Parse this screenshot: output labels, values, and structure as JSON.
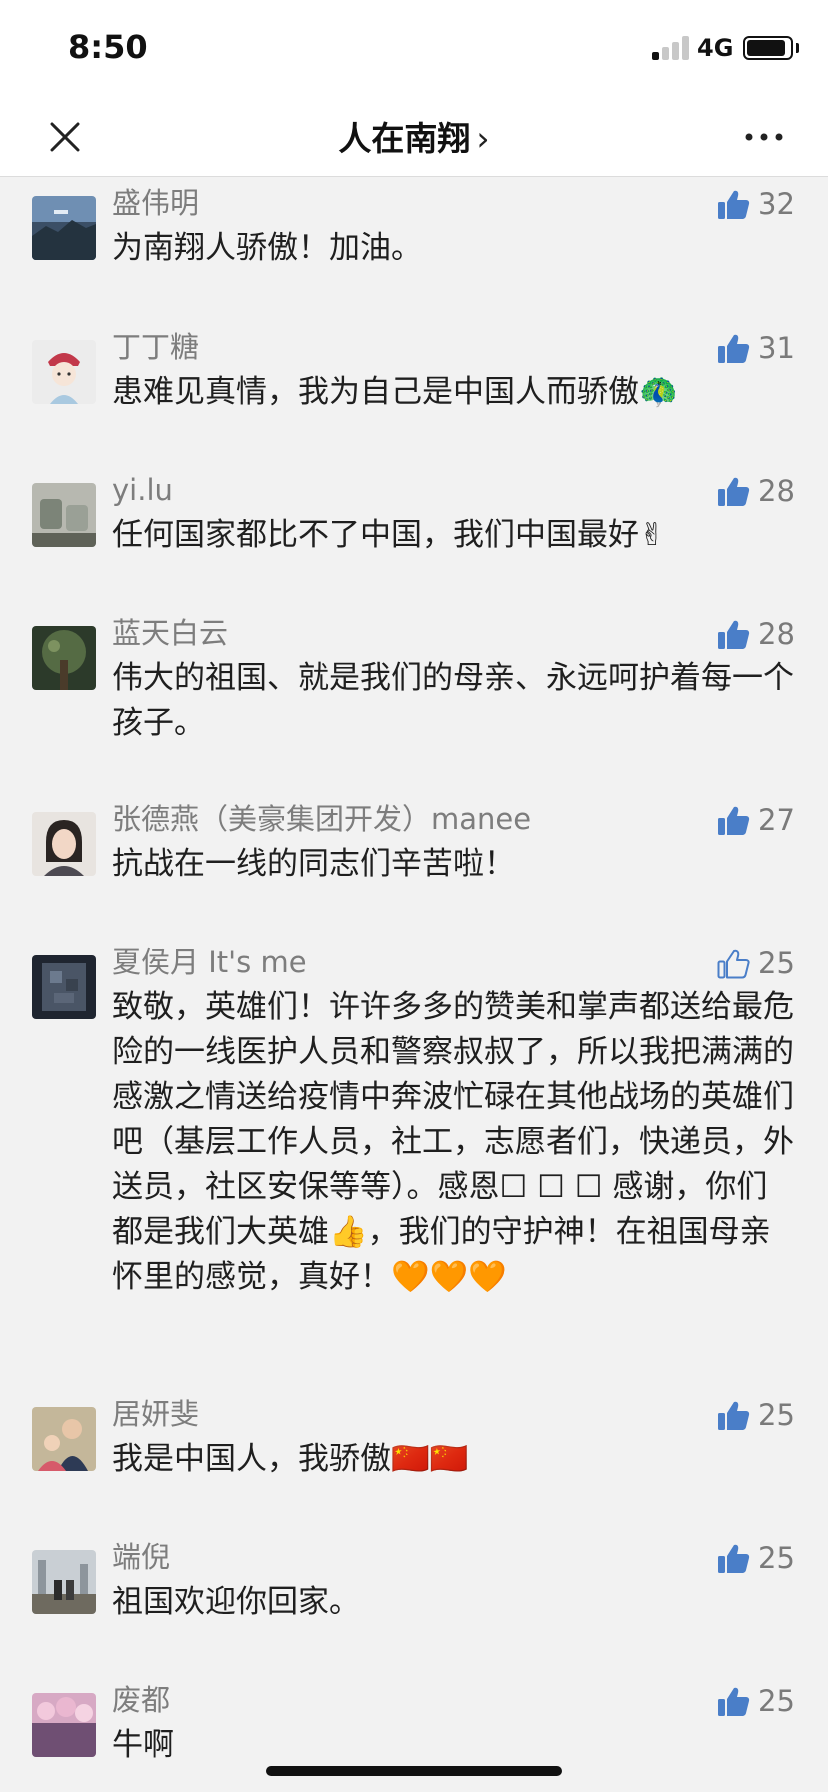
{
  "status_bar": {
    "time": "8:50",
    "network": "4G",
    "signal_bars_active": 1
  },
  "nav": {
    "title": "人在南翔",
    "chevron": "›",
    "close_icon": "close-icon",
    "more_icon": "more-icon"
  },
  "colors": {
    "like_icon": "#4a7ec8",
    "author": "#7d7d7d",
    "body_text": "#1f1f1f",
    "background": "#f2f2f2"
  },
  "comments": [
    {
      "author": "盛伟明",
      "likes": "32",
      "liked": true,
      "text": "为南翔人骄傲！加油。"
    },
    {
      "author": "丁丁糖",
      "likes": "31",
      "liked": true,
      "text": "患难见真情，我为自己是中国人而骄傲🦚"
    },
    {
      "author": "yi.lu",
      "likes": "28",
      "liked": true,
      "text": "任何国家都比不了中国，我们中国最好✌"
    },
    {
      "author": "蓝天白云",
      "likes": "28",
      "liked": true,
      "text": "伟大的祖国、就是我们的母亲、永远呵护着每一个孩子。"
    },
    {
      "author": "张德燕（美豪集团开发）manee",
      "likes": "27",
      "liked": true,
      "text": "抗战在一线的同志们辛苦啦！"
    },
    {
      "author": "夏侯月 It's me",
      "likes": "25",
      "liked": false,
      "text": "致敬，英雄们！许许多多的赞美和掌声都送给最危险的一线医护人员和警察叔叔了，所以我把满满的感激之情送给疫情中奔波忙碌在其他战场的英雄们吧（基层工作人员，社工，志愿者们，快递员，外送员，社区安保等等）。感恩☐ ☐ ☐ 感谢，你们都是我们大英雄👍，我们的守护神！在祖国母亲怀里的感觉，真好！🧡🧡🧡"
    },
    {
      "author": "居妍斐",
      "likes": "25",
      "liked": true,
      "text": "我是中国人，我骄傲🇨🇳🇨🇳"
    },
    {
      "author": "端倪",
      "likes": "25",
      "liked": true,
      "text": "祖国欢迎你回家。"
    },
    {
      "author": "废都",
      "likes": "25",
      "liked": true,
      "text": "牛啊"
    }
  ]
}
